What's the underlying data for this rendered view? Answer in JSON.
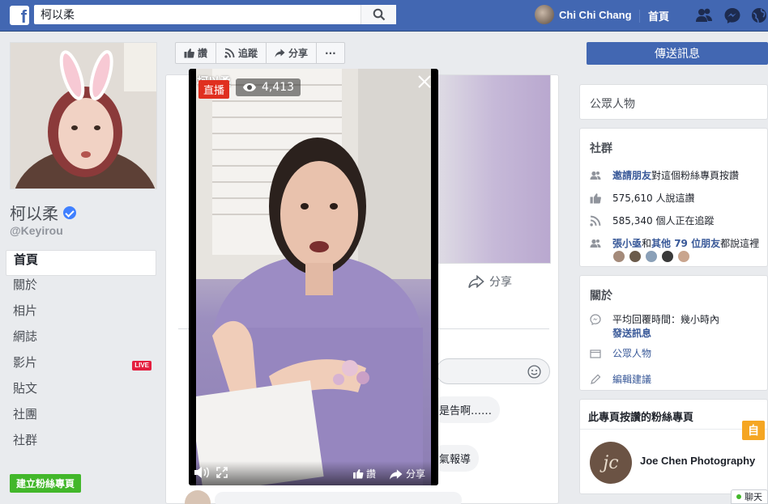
{
  "topbar": {
    "logo": "f",
    "search_value": "柯以柔",
    "user_name": "Chi Chi Chang",
    "home_label": "首頁"
  },
  "profile": {
    "name": "柯以柔",
    "handle": "@Keyirou"
  },
  "nav": {
    "items": [
      {
        "label": "首頁"
      },
      {
        "label": "關於"
      },
      {
        "label": "相片"
      },
      {
        "label": "網誌"
      },
      {
        "label": "影片"
      },
      {
        "label": "貼文"
      },
      {
        "label": "社團"
      },
      {
        "label": "社群"
      }
    ],
    "live_badge": "LIVE",
    "create_page_label": "建立粉絲專頁"
  },
  "actions": {
    "like": "讚",
    "follow": "追蹤",
    "share": "分享",
    "more": "···",
    "send_message": "傳送訊息"
  },
  "feed": {
    "share_label": "分享",
    "bubble_1": "是告啊……",
    "bubble_2": "氣報導"
  },
  "video": {
    "title": "柯以柔",
    "live_label": "直播",
    "viewer_count": "4,413",
    "like_label": "讚",
    "share_label": "分享"
  },
  "right": {
    "category": "公眾人物",
    "community": {
      "title": "社群",
      "invite_link": "邀請朋友",
      "invite_text": "對這個粉絲專頁按讚",
      "likes": "575,610 人說這讚",
      "followers": "585,340 個人正在追蹤",
      "friends_name": "張小亟",
      "friends_and": "和",
      "friends_others": "其他 79 位朋友",
      "friends_tail": "都說這裡"
    },
    "about": {
      "title": "關於",
      "response": "平均回覆時間：幾小時內",
      "send_message": "發送訊息",
      "category": "公眾人物",
      "edit_suggest": "編輯建議"
    },
    "liked_pages": {
      "title": "此專頁按讚的粉絲專頁",
      "page_logo": "jc",
      "page_name": "Joe Chen Photography"
    },
    "yellow_tab": "自",
    "chat_label": "聊天"
  },
  "colors": {
    "fb_blue": "#4267b2",
    "live_red": "#e41e3f",
    "create_green": "#42b72a",
    "link_blue": "#385898"
  }
}
